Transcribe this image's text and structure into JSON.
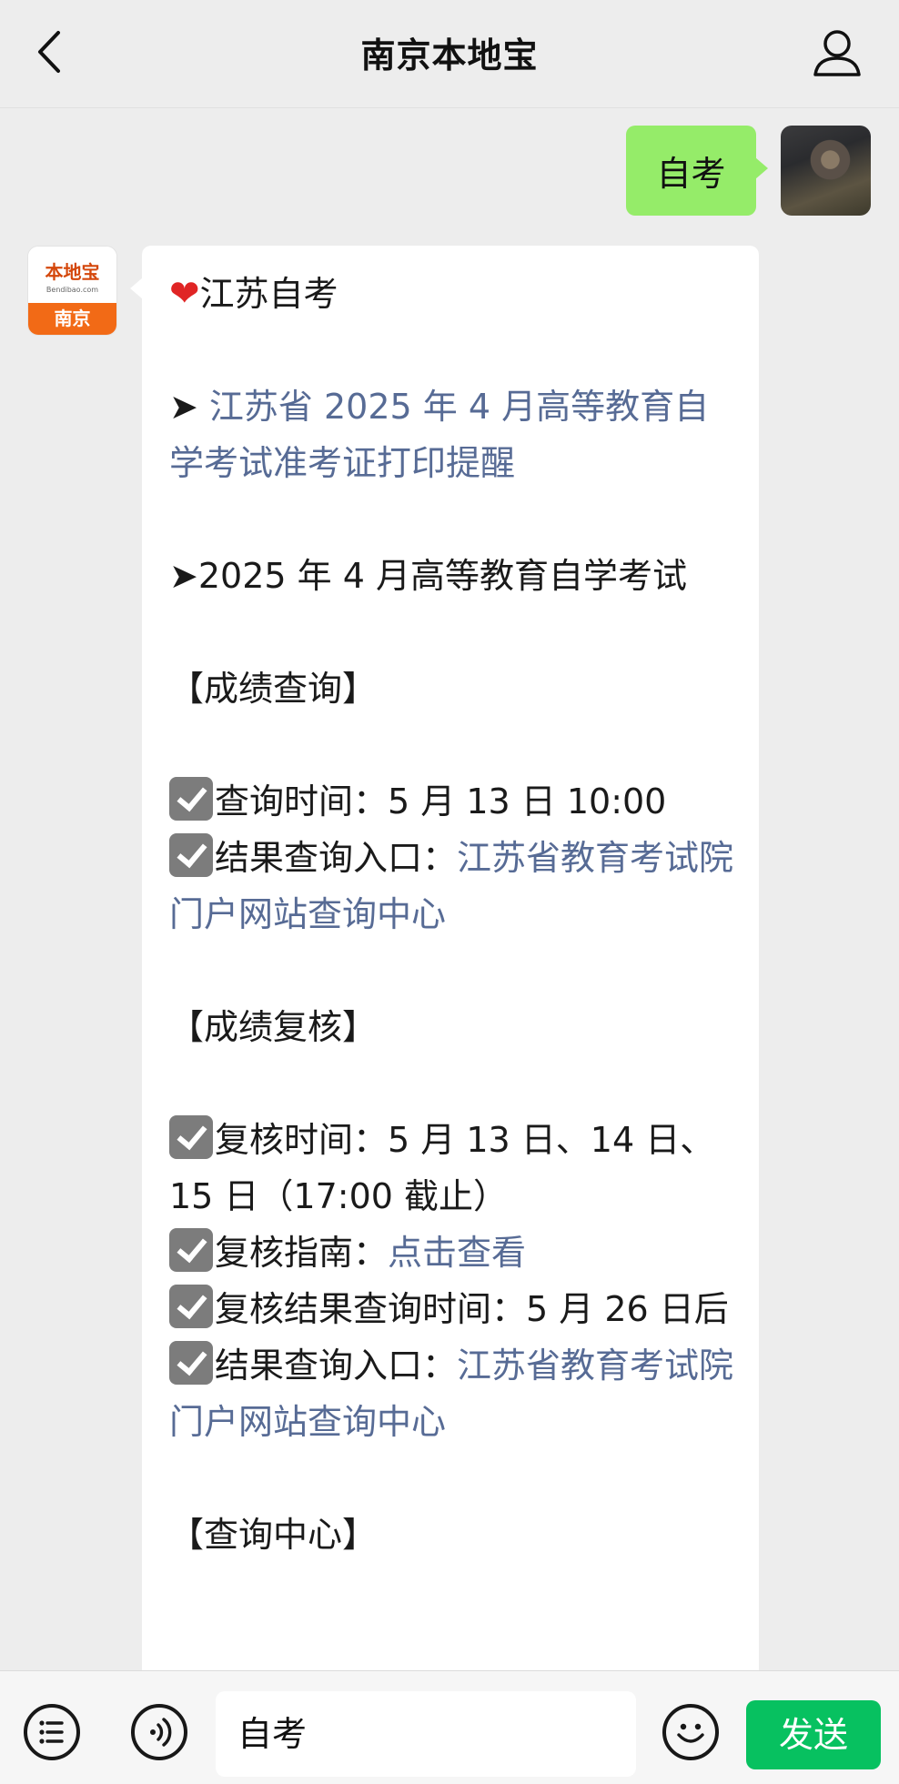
{
  "header": {
    "title": "南京本地宝",
    "back_icon": "chevron-left-icon",
    "profile_icon": "person-icon"
  },
  "chat": {
    "outgoing": {
      "text": "自考"
    },
    "incoming": {
      "avatar": {
        "logo_text": "本地宝",
        "logo_sub": "Bendibao.com",
        "city": "南京"
      },
      "lines": {
        "heading": "江苏自考",
        "arrow1_prefix": "➤ ",
        "arrow1_link": "江苏省 2025 年 4 月高等教育自学考试准考证打印提醒",
        "arrow2": "➤2025 年 4 月高等教育自学考试",
        "section1": "【成绩查询】",
        "query_time": "查询时间：5 月 13 日 10:00",
        "result_entry_label": "结果查询入口：",
        "result_entry_link": "江苏省教育考试院门户网站查询中心",
        "section2": "【成绩复核】",
        "review_time": "复核时间：5 月 13 日、14 日、15 日（17:00 截止）",
        "review_guide_label": "复核指南：",
        "review_guide_link": "点击查看",
        "review_result_time": "复核结果查询时间：5 月 26 日后",
        "result_entry2_label": "结果查询入口：",
        "result_entry2_link": "江苏省教育考试院门户网站查询中心",
        "section3": "【查询中心】"
      }
    }
  },
  "input_bar": {
    "menu_icon": "list-menu-icon",
    "voice_icon": "voice-icon",
    "input_value": "自考",
    "emoji_icon": "smiley-icon",
    "send_label": "发送"
  },
  "colors": {
    "link": "#576b95",
    "outgoing_bubble": "#95ec69",
    "send_button": "#07c160",
    "brand_orange": "#f26a16"
  }
}
